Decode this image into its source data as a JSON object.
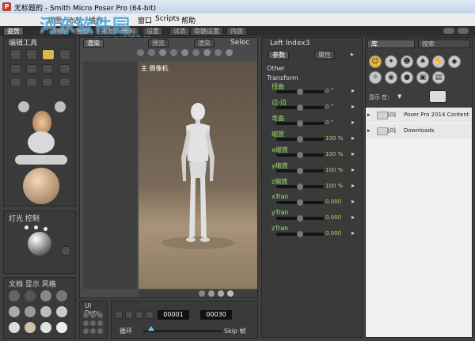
{
  "window": {
    "title": "无标题的 - Smith Micro Poser Pro  (64-bit)",
    "app_icon": "P"
  },
  "menu": [
    "视图",
    "动态",
    "插件",
    "窗口",
    "Scripts",
    "帮助"
  ],
  "tabs": [
    "姿势",
    "材质",
    "脸部",
    "头发",
    "布料",
    "设置",
    "试衣",
    "骨骼设置",
    "内容"
  ],
  "watermark": {
    "line1": "河东软件园",
    "line2": "www.pc0359.cn"
  },
  "left_panel": {
    "editing_tools_label": "编辑工具",
    "light_control_label": "灯光 控制",
    "doc_style_label": "文档 显示 风格",
    "ui_dots_label": "UI Dots"
  },
  "viewport": {
    "tab_label": "渲染",
    "preview_tab": "预览",
    "render_tab": "渲染",
    "camera_label": "主 摄像机",
    "select_label": "Selec"
  },
  "animation": {
    "frame_current": "00001",
    "frame_total": "00030",
    "loop_label": "循环",
    "skip_label": "Skip 帧"
  },
  "param_panel": {
    "title": "Left Index3",
    "tab_params": "参数",
    "tab_props": "属性",
    "groups": [
      "Other",
      "Transform"
    ],
    "rows": [
      {
        "label": "扭曲",
        "value": "0 °",
        "knob": 0.5
      },
      {
        "label": "边-边",
        "value": "0 °",
        "knob": 0.5
      },
      {
        "label": "弯曲",
        "value": "0 °",
        "knob": 0.5
      },
      {
        "label": "缩放",
        "value": "100 %",
        "knob": 0.5
      },
      {
        "label": "x缩放",
        "value": "100 %",
        "knob": 0.5
      },
      {
        "label": "y缩放",
        "value": "100 %",
        "knob": 0.5
      },
      {
        "label": "z缩放",
        "value": "100 %",
        "knob": 0.5
      },
      {
        "label": "xTran",
        "value": "0.000",
        "knob": 0.5
      },
      {
        "label": "yTran",
        "value": "0.000",
        "knob": 0.5
      },
      {
        "label": "zTran",
        "value": "0.000",
        "knob": 0.5
      }
    ]
  },
  "library": {
    "tab_library": "库",
    "tab_search": "搜索",
    "show_label": "显示 在:",
    "items": [
      {
        "id": "[0]",
        "name": "Poser Pro 2014 Content"
      },
      {
        "id": "[0]",
        "name": "Downloads"
      }
    ]
  }
}
